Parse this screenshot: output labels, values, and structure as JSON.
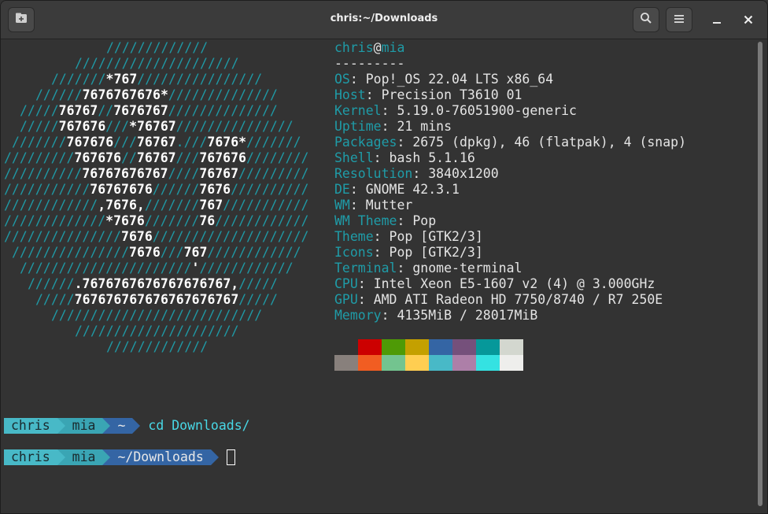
{
  "window": {
    "title": "chris:~/Downloads"
  },
  "titlebar": {
    "new_tab_icon": "new-tab-icon",
    "search_icon": "search-icon",
    "menu_icon": "hamburger-menu-icon",
    "minimize_icon": "minimize-icon",
    "close_icon": "close-icon"
  },
  "ascii_art": [
    [
      "/////////////"
    ],
    [
      "/////////////////////"
    ],
    [
      "///////",
      "*767",
      "////////////////"
    ],
    [
      "//////",
      "7676767676*",
      "//////////////"
    ],
    [
      "/////",
      "76767",
      "//",
      "7676767",
      "//////////////"
    ],
    [
      "/////",
      "767676",
      "///",
      "*76767",
      "///////////////"
    ],
    [
      "///////",
      "767676",
      "///",
      "76767",
      ".///",
      "7676*",
      "///////"
    ],
    [
      "/////////",
      "767676",
      "//",
      "76767",
      "///",
      "767676",
      "////////"
    ],
    [
      "//////////",
      "76767676767",
      "////",
      "76767",
      "/////////"
    ],
    [
      "///////////",
      "76767676",
      "//////",
      "7676",
      "//////////"
    ],
    [
      "////////////",
      ",7676,",
      "///////",
      "767",
      "///////////"
    ],
    [
      "/////////////",
      "*7676",
      "///////",
      "76",
      "////////////"
    ],
    [
      "///////////////",
      "7676",
      "////////////////////"
    ],
    [
      "///////////////",
      "7676",
      "///",
      "767",
      "////////////"
    ],
    [
      "//////////////////////",
      "'",
      "////////////"
    ],
    [
      "//////",
      ".7676767676767676767,",
      "/////"
    ],
    [
      "/////",
      "767676767676767676767",
      "/////"
    ],
    [
      "///////////////////////////"
    ],
    [
      "/////////////////////"
    ],
    [
      "/////////////"
    ]
  ],
  "sysinfo": {
    "user": "chris",
    "at": "@",
    "host": "mia",
    "separator": "---------",
    "rows": [
      {
        "key": "OS",
        "value": "Pop!_OS 22.04 LTS x86_64"
      },
      {
        "key": "Host",
        "value": "Precision T3610 01"
      },
      {
        "key": "Kernel",
        "value": "5.19.0-76051900-generic"
      },
      {
        "key": "Uptime",
        "value": "21 mins"
      },
      {
        "key": "Packages",
        "value": "2675 (dpkg), 46 (flatpak), 4 (snap)"
      },
      {
        "key": "Shell",
        "value": "bash 5.1.16"
      },
      {
        "key": "Resolution",
        "value": "3840x1200"
      },
      {
        "key": "DE",
        "value": "GNOME 42.3.1"
      },
      {
        "key": "WM",
        "value": "Mutter"
      },
      {
        "key": "WM Theme",
        "value": "Pop"
      },
      {
        "key": "Theme",
        "value": "Pop [GTK2/3]"
      },
      {
        "key": "Icons",
        "value": "Pop [GTK2/3]"
      },
      {
        "key": "Terminal",
        "value": "gnome-terminal"
      },
      {
        "key": "CPU",
        "value": "Intel Xeon E5-1607 v2 (4) @ 3.000GHz"
      },
      {
        "key": "GPU",
        "value": "AMD ATI Radeon HD 7750/8740 / R7 250E"
      },
      {
        "key": "Memory",
        "value": "4135MiB / 28017MiB"
      }
    ],
    "palette_top": [
      "#333333",
      "#cc0000",
      "#4e9a06",
      "#c4a000",
      "#3465a4",
      "#75507b",
      "#06989a",
      "#d3d7cf"
    ],
    "palette_bottom": [
      "#88807c",
      "#f15d22",
      "#73c48f",
      "#ffce51",
      "#48b9c7",
      "#ad7fa8",
      "#34e2e2",
      "#eeeeec"
    ]
  },
  "prompts": [
    {
      "user": "chris",
      "host": "mia",
      "dir": "~",
      "command": "cd Downloads/"
    },
    {
      "user": "chris",
      "host": "mia",
      "dir": "~/Downloads",
      "command": ""
    }
  ],
  "colors": {
    "prompt_user_bg": "#48b9c7",
    "prompt_host_bg": "#3aa5b4",
    "prompt_dir_bg": "#3465a4",
    "prompt_user_fg": "#1a2a2e",
    "prompt_dir_fg": "#e8e8e8",
    "command_fg": "#48d8e6"
  }
}
